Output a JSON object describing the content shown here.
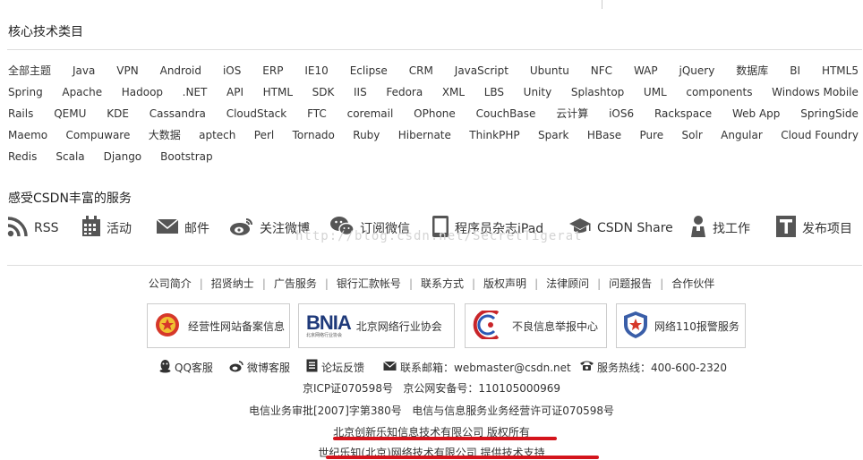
{
  "section_tags_title": "核心技术类目",
  "tag_rows": [
    [
      "全部主题",
      "Java",
      "VPN",
      "Android",
      "iOS",
      "ERP",
      "IE10",
      "Eclipse",
      "CRM",
      "JavaScript",
      "Ubuntu",
      "NFC",
      "WAP",
      "jQuery",
      "数据库",
      "BI",
      "HTML5"
    ],
    [
      "Spring",
      "Apache",
      "Hadoop",
      ".NET",
      "API",
      "HTML",
      "SDK",
      "IIS",
      "Fedora",
      "XML",
      "LBS",
      "Unity",
      "Splashtop",
      "UML",
      "components",
      "Windows Mobile"
    ],
    [
      "Rails",
      "QEMU",
      "KDE",
      "Cassandra",
      "CloudStack",
      "FTC",
      "coremail",
      "OPhone",
      "CouchBase",
      "云计算",
      "iOS6",
      "Rackspace",
      "Web App",
      "SpringSide"
    ],
    [
      "Maemo",
      "Compuware",
      "大数据",
      "aptech",
      "Perl",
      "Tornado",
      "Ruby",
      "Hibernate",
      "ThinkPHP",
      "Spark",
      "HBase",
      "Pure",
      "Solr",
      "Angular",
      "Cloud Foundry"
    ],
    [
      "Redis",
      "Scala",
      "Django",
      "Bootstrap"
    ]
  ],
  "section_services_title": "感受CSDN丰富的服务",
  "services": [
    {
      "label": "RSS",
      "icon": "rss-icon"
    },
    {
      "label": "活动",
      "icon": "calendar-icon"
    },
    {
      "label": "邮件",
      "icon": "mail-icon"
    },
    {
      "label": "关注微博",
      "icon": "weibo-icon"
    },
    {
      "label": "订阅微信",
      "icon": "wechat-icon"
    },
    {
      "label": "程序员杂志iPad",
      "icon": "ipad-icon"
    },
    {
      "label": "CSDN Share",
      "icon": "graduation-cap-icon"
    },
    {
      "label": "找工作",
      "icon": "person-icon"
    },
    {
      "label": "发布项目",
      "icon": "post-project-icon"
    }
  ],
  "watermark": "http://blog.csdn.net/SecretTigerat",
  "footer_links": [
    "公司简介",
    "招贤纳士",
    "广告服务",
    "银行汇款帐号",
    "联系方式",
    "版权声明",
    "法律顾问",
    "问题报告",
    "合作伙伴"
  ],
  "badges": [
    {
      "label": "经营性网站备案信息",
      "icon": "police-emblem-icon"
    },
    {
      "label": "北京网络行业协会",
      "logo": "BNIA",
      "sublabel": "北京网络行业协会"
    },
    {
      "label": "不良信息举报中心",
      "icon": "report-center-icon"
    },
    {
      "label": "网络110报警服务",
      "icon": "police-110-icon"
    }
  ],
  "contacts": {
    "qq": "QQ客服",
    "weibo": "微博客服",
    "forum": "论坛反馈",
    "email_label": "联系邮箱：webmaster@csdn.net",
    "hotline": "服务热线：400-600-2320"
  },
  "icp_line": "京ICP证070598号   京公网安备号：110105000969",
  "license_line": "电信业务审批[2007]字第380号   电信与信息服务业务经营许可证070598号",
  "copyright_line": "北京创新乐知信息技术有限公司 版权所有",
  "support_line": "世纪乐知(北京)网络技术有限公司 提供技术支持",
  "colors": {
    "underline_red": "#d4141c",
    "text": "#333333",
    "rule": "#dddddd"
  }
}
